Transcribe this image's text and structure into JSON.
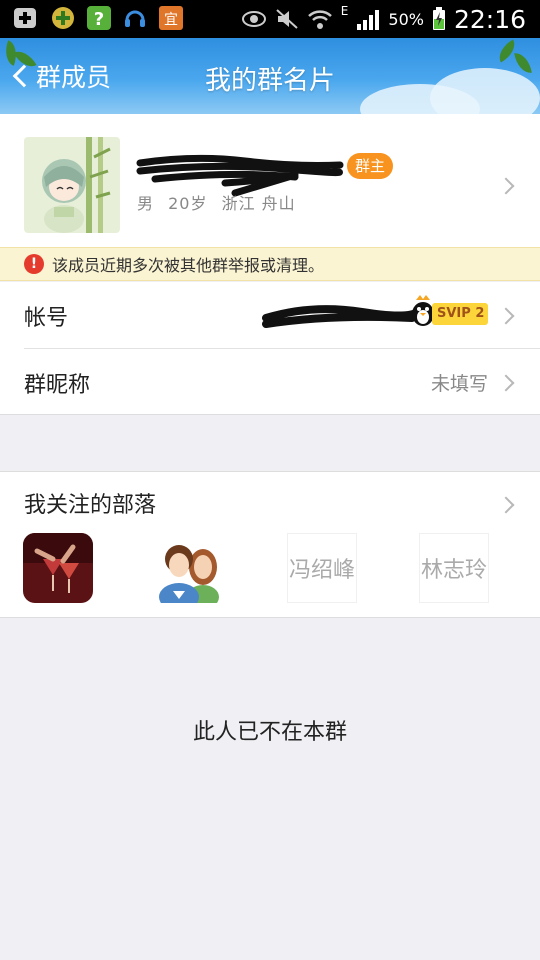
{
  "status_bar": {
    "battery_percent": "50%",
    "time": "22:16",
    "network_label": "E"
  },
  "header": {
    "back_label": "群成员",
    "title": "我的群名片"
  },
  "profile": {
    "owner_badge": "群主",
    "gender": "男",
    "age": "20岁",
    "location": "浙江 舟山"
  },
  "warning": {
    "text": "该成员近期多次被其他群举报或清理。"
  },
  "rows": [
    {
      "label": "帐号",
      "svip": "SVIP 2"
    },
    {
      "label": "群昵称",
      "value": "未填写"
    }
  ],
  "tribe": {
    "title": "我关注的部落",
    "items": [
      {
        "type": "image",
        "icon": "drinks-image"
      },
      {
        "type": "image",
        "icon": "couple-image"
      },
      {
        "type": "text",
        "label": "冯绍峰"
      },
      {
        "type": "text",
        "label": "林志玲"
      }
    ]
  },
  "notice": "此人已不在本群",
  "colors": {
    "header_blue": "#2f8fe0",
    "owner_badge": "#f7931e",
    "warning_bg": "#fbf4d2",
    "svip_bg": "#fbd53a"
  }
}
